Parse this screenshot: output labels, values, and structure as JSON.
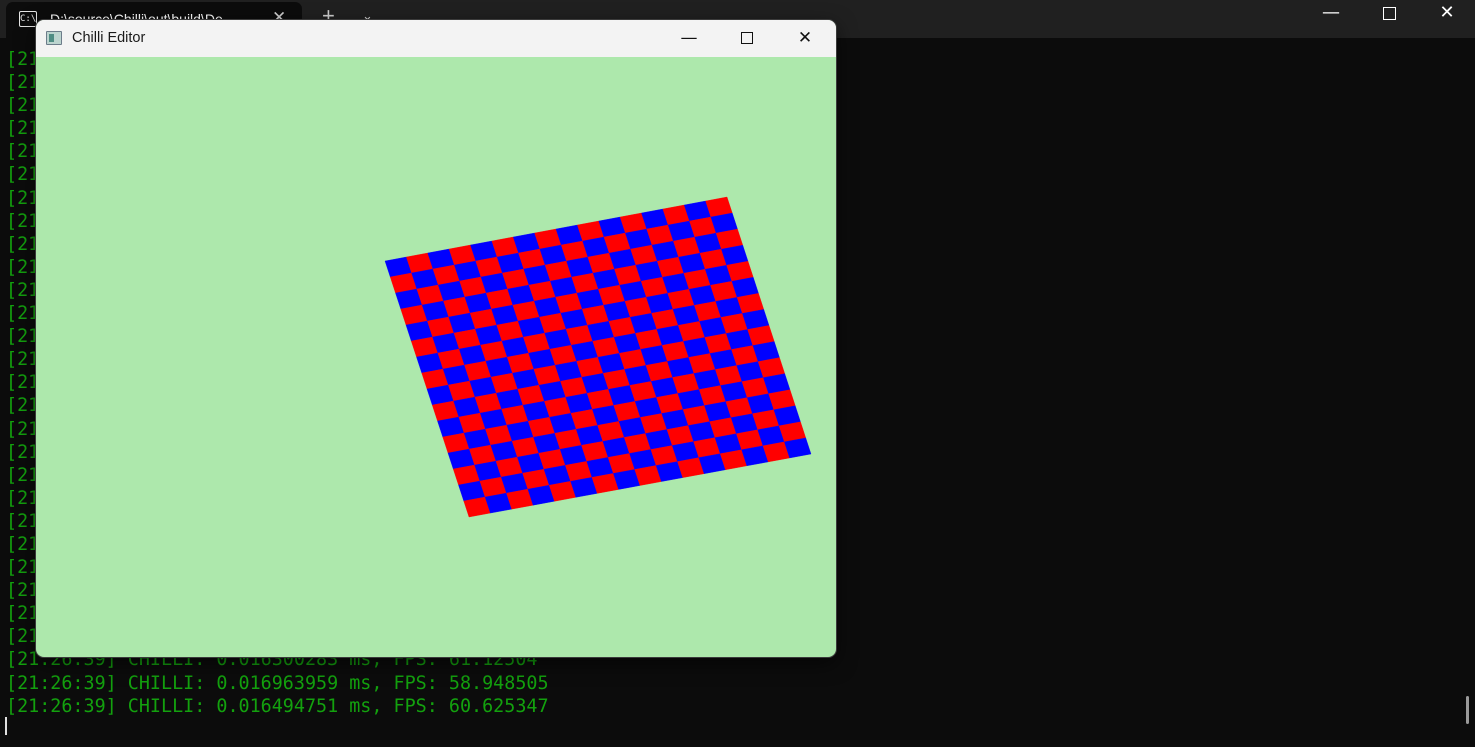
{
  "terminal": {
    "tab_title": "D:\\source\\Chilli\\out\\build\\De",
    "tab_icon": "terminal-icon",
    "new_tab_glyph": "+",
    "dropdown_glyph": "⌄",
    "tab_close_glyph": "✕",
    "minimize_glyph": "—",
    "close_glyph": "✕",
    "text_color": "#13a10e",
    "partial_lines": [
      "[21",
      "[21",
      "[21",
      "[21",
      "[21",
      "[21",
      "[21",
      "[21",
      "[21",
      "[21",
      "[21",
      "[21",
      "[21",
      "[21",
      "[21",
      "[21",
      "[21",
      "[21",
      "[21",
      "[21",
      "[21",
      "[21",
      "[21",
      "[21",
      "[21",
      "[21"
    ],
    "lines": [
      "[21:26:39] CHILLI: 0.016300283 ms, FPS: 61.12504",
      "[21:26:39] CHILLI: 0.016963959 ms, FPS: 58.948505",
      "[21:26:39] CHILLI: 0.016494751 ms, FPS: 60.625347"
    ]
  },
  "editor": {
    "title": "Chilli Editor",
    "minimize_glyph": "—",
    "close_glyph": "✕",
    "background_color": "#ade8ac",
    "checkerboard": {
      "rows": 16,
      "cols": 16,
      "color_a": "#0000ff",
      "color_b": "#ff0000"
    }
  }
}
